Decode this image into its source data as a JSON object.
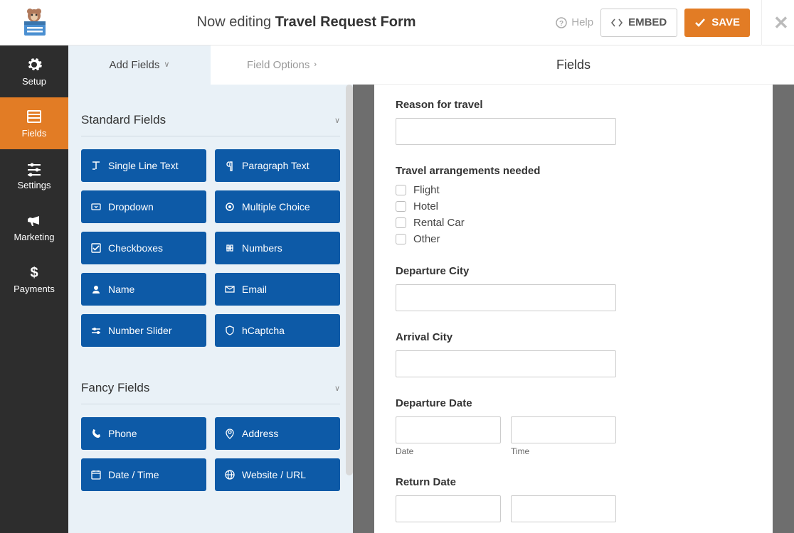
{
  "header": {
    "editing_prefix": "Now editing",
    "form_name": "Travel Request Form",
    "help": "Help",
    "embed": "EMBED",
    "save": "SAVE"
  },
  "sidebar": {
    "items": [
      {
        "label": "Setup"
      },
      {
        "label": "Fields"
      },
      {
        "label": "Settings"
      },
      {
        "label": "Marketing"
      },
      {
        "label": "Payments"
      }
    ]
  },
  "panel": {
    "tabs": {
      "add": "Add Fields",
      "options": "Field Options"
    },
    "sections": {
      "standard": {
        "title": "Standard Fields",
        "items": [
          "Single Line Text",
          "Paragraph Text",
          "Dropdown",
          "Multiple Choice",
          "Checkboxes",
          "Numbers",
          "Name",
          "Email",
          "Number Slider",
          "hCaptcha"
        ]
      },
      "fancy": {
        "title": "Fancy Fields",
        "items": [
          "Phone",
          "Address",
          "Date / Time",
          "Website / URL"
        ]
      }
    }
  },
  "preview": {
    "heading": "Fields",
    "f1": {
      "label": "Reason for travel"
    },
    "f2": {
      "label": "Travel arrangements needed",
      "opts": [
        "Flight",
        "Hotel",
        "Rental Car",
        "Other"
      ]
    },
    "f3": {
      "label": "Departure City"
    },
    "f4": {
      "label": "Arrival City"
    },
    "f5": {
      "label": "Departure Date",
      "sub_date": "Date",
      "sub_time": "Time"
    },
    "f6": {
      "label": "Return Date"
    }
  }
}
